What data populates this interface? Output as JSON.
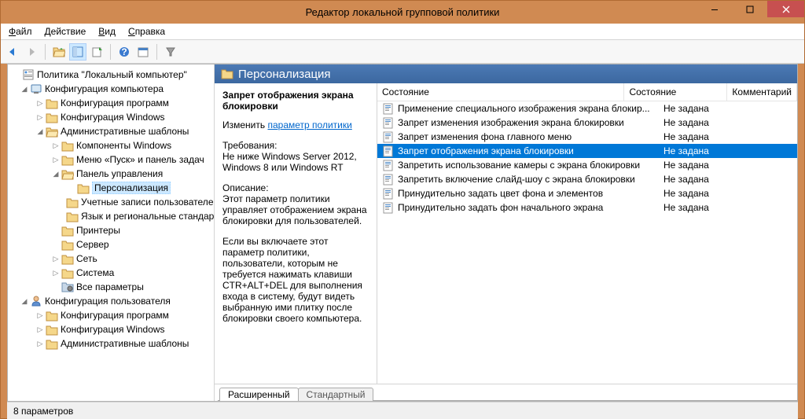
{
  "window": {
    "title": "Редактор локальной групповой политики"
  },
  "menu": [
    "Файл",
    "Действие",
    "Вид",
    "Справка"
  ],
  "tree": {
    "root": "Политика \"Локальный компьютер\"",
    "comp_cfg": "Конфигурация компьютера",
    "prog_cfg": "Конфигурация программ",
    "win_cfg": "Конфигурация Windows",
    "adm_tpl": "Административные шаблоны",
    "win_comp": "Компоненты Windows",
    "start_menu": "Меню «Пуск» и панель задач",
    "ctrl_panel": "Панель управления",
    "personalization": "Персонализация",
    "user_accounts": "Учетные записи пользователей",
    "lang_regional": "Язык и региональные стандарты",
    "printers": "Принтеры",
    "server": "Сервер",
    "network": "Сеть",
    "system": "Система",
    "all_params": "Все параметры",
    "user_cfg": "Конфигурация пользователя",
    "u_prog_cfg": "Конфигурация программ",
    "u_win_cfg": "Конфигурация Windows",
    "u_adm_tpl": "Административные шаблоны"
  },
  "header": {
    "title": "Персонализация"
  },
  "desc": {
    "title": "Запрет отображения экрана блокировки",
    "edit_label": "Изменить",
    "link": "параметр политики",
    "req_label": "Требования:",
    "req_text": "Не ниже Windows Server 2012, Windows 8 или Windows RT",
    "desc_label": "Описание:",
    "desc_text": "Этот параметр политики управляет отображением экрана блокировки для пользователей.",
    "desc_text2": "Если вы включаете этот параметр политики, пользователи, которым не требуется нажимать клавиши CTR+ALT+DEL для выполнения входа в систему, будут видеть выбранную ими плитку после блокировки своего компьютера."
  },
  "list": {
    "columns": [
      "Состояние",
      "Состояние",
      "Комментарий"
    ],
    "rows": [
      {
        "name": "Применение специального изображения экрана блокир...",
        "state": "Не задана",
        "selected": false
      },
      {
        "name": "Запрет изменения изображения экрана блокировки",
        "state": "Не задана",
        "selected": false
      },
      {
        "name": "Запрет изменения фона главного меню",
        "state": "Не задана",
        "selected": false
      },
      {
        "name": "Запрет отображения экрана блокировки",
        "state": "Не задана",
        "selected": true
      },
      {
        "name": "Запретить использование камеры с экрана блокировки",
        "state": "Не задана",
        "selected": false
      },
      {
        "name": "Запретить включение слайд-шоу с экрана блокировки",
        "state": "Не задана",
        "selected": false
      },
      {
        "name": "Принудительно задать цвет фона и элементов",
        "state": "Не задана",
        "selected": false
      },
      {
        "name": "Принудительно задать фон начального экрана",
        "state": "Не задана",
        "selected": false
      }
    ]
  },
  "tabs": {
    "extended": "Расширенный",
    "standard": "Стандартный"
  },
  "status": "8 параметров"
}
